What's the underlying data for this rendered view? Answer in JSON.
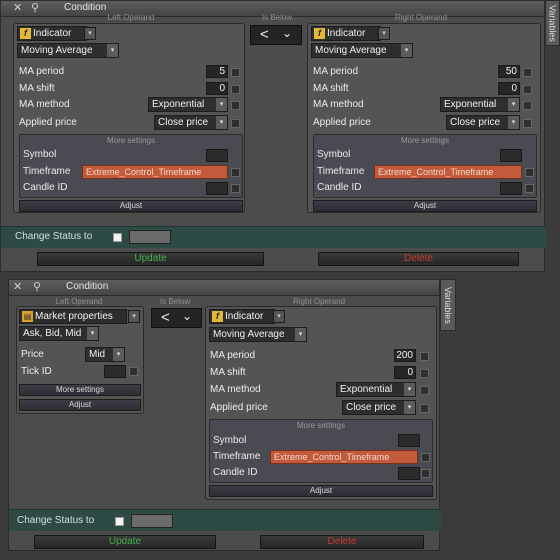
{
  "window1": {
    "title": "Condition",
    "side_tab": "Variables",
    "left_group": "Left Operand",
    "mid_group": "Is Below",
    "right_group": "Right Operand",
    "operator": "<",
    "left": {
      "type": "Indicator",
      "indicator": "Moving Average",
      "fields": [
        {
          "label": "MA period",
          "value": "5"
        },
        {
          "label": "MA shift",
          "value": "0"
        }
      ],
      "ma_method_label": "MA method",
      "ma_method": "Exponential",
      "applied_price_label": "Applied price",
      "applied_price": "Close price",
      "more_settings": "More settings",
      "symbol_label": "Symbol",
      "timeframe_label": "Timeframe",
      "timeframe": "Extreme_Control_Timeframe",
      "candle_label": "Candle ID",
      "adjust": "Adjust"
    },
    "right": {
      "type": "Indicator",
      "indicator": "Moving Average",
      "fields": [
        {
          "label": "MA period",
          "value": "50"
        },
        {
          "label": "MA shift",
          "value": "0"
        }
      ],
      "ma_method_label": "MA method",
      "ma_method": "Exponential",
      "applied_price_label": "Applied price",
      "applied_price": "Close price",
      "more_settings": "More settings",
      "symbol_label": "Symbol",
      "timeframe_label": "Timeframe",
      "timeframe": "Extreme_Control_Timeframe",
      "candle_label": "Candle ID",
      "adjust": "Adjust"
    },
    "change_status": "Change Status to",
    "update": "Update",
    "delete": "Delete"
  },
  "window2": {
    "title": "Condition",
    "side_tab": "Variables",
    "left_group": "Left Operand",
    "mid_group": "Is Below",
    "right_group": "Right Operand",
    "operator": "<",
    "left": {
      "type": "Market properties",
      "property": "Ask, Bid, Mid",
      "price_label": "Price",
      "price": "Mid",
      "tick_label": "Tick ID",
      "more_settings": "More settings",
      "adjust": "Adjust"
    },
    "right": {
      "type": "Indicator",
      "indicator": "Moving Average",
      "fields": [
        {
          "label": "MA period",
          "value": "200"
        },
        {
          "label": "MA shift",
          "value": "0"
        }
      ],
      "ma_method_label": "MA method",
      "ma_method": "Exponential",
      "applied_price_label": "Applied price",
      "applied_price": "Close price",
      "more_settings": "More settings",
      "symbol_label": "Symbol",
      "timeframe_label": "Timeframe",
      "timeframe": "Extreme_Control_Timeframe",
      "candle_label": "Candle ID",
      "adjust": "Adjust"
    },
    "change_status": "Change Status to",
    "update": "Update",
    "delete": "Delete"
  },
  "colors": {
    "update": "#3fb04a",
    "delete": "#c23a30",
    "timeframe": "#c35a3c",
    "status_bar": "#2e4a44"
  }
}
